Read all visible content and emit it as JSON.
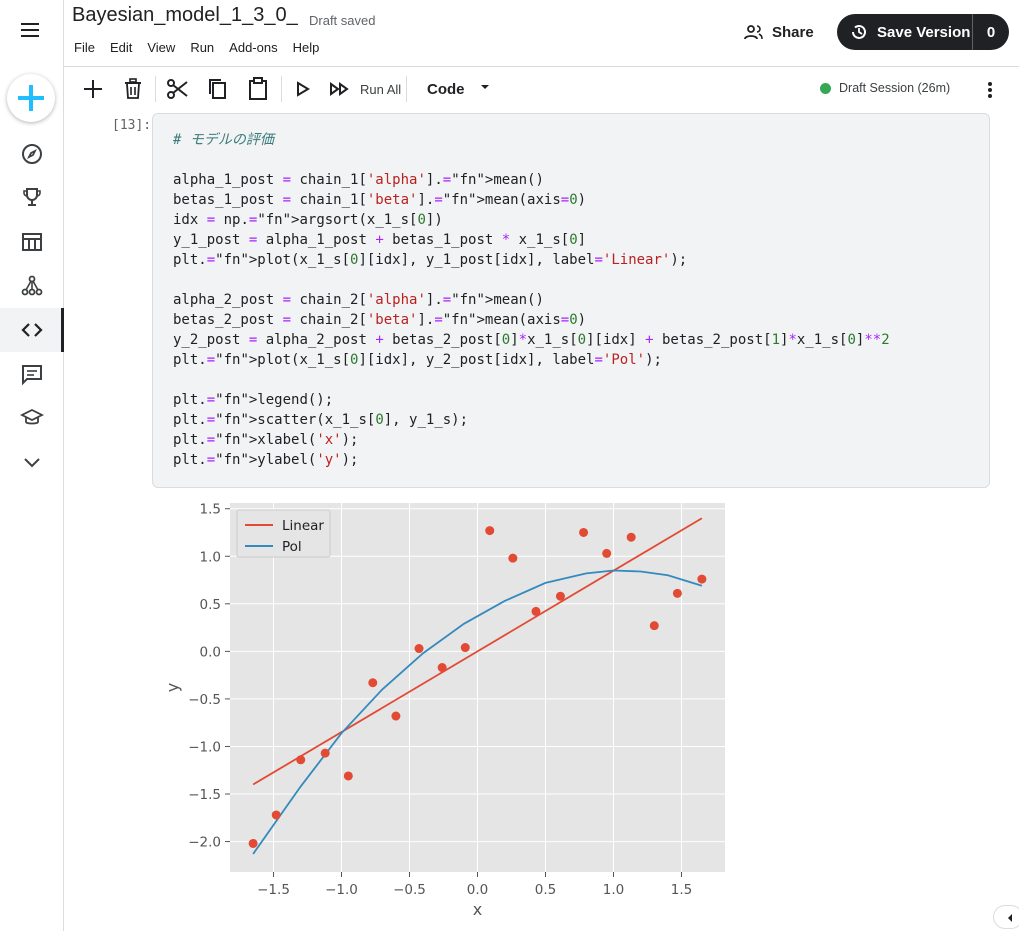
{
  "app": {
    "notebook_title": "Bayesian_model_1_3_0_",
    "save_status": "Draft saved",
    "menus": [
      "File",
      "Edit",
      "View",
      "Run",
      "Add-ons",
      "Help"
    ],
    "share_label": "Share",
    "save_version_label": "Save Version",
    "version_count": "0"
  },
  "sidebar": {
    "icons": [
      "menu-icon",
      "create-icon",
      "explore-icon",
      "competitions-icon",
      "datasets-icon",
      "models-icon",
      "code-icon",
      "discussions-icon",
      "learn-icon",
      "more-icon"
    ],
    "active": "code-icon"
  },
  "toolbar": {
    "run_all_label": "Run All",
    "cell_type": "Code",
    "session_status": "Draft Session (26m)",
    "session_color": "#34a853"
  },
  "cell": {
    "execution_count": "[13]:",
    "lines": [
      "# モデルの評価",
      "",
      "alpha_1_post = chain_1['alpha'].mean()",
      "betas_1_post = chain_1['beta'].mean(axis=0)",
      "idx = np.argsort(x_1_s[0])",
      "y_1_post = alpha_1_post + betas_1_post * x_1_s[0]",
      "plt.plot(x_1_s[0][idx], y_1_post[idx], label='Linear');",
      "",
      "alpha_2_post = chain_2['alpha'].mean()",
      "betas_2_post = chain_2['beta'].mean(axis=0)",
      "y_2_post = alpha_2_post + betas_2_post[0]*x_1_s[0][idx] + betas_2_post[1]*x_1_s[0]**2",
      "plt.plot(x_1_s[0][idx], y_2_post[idx], label='Pol');",
      "",
      "plt.legend();",
      "plt.scatter(x_1_s[0], y_1_s);",
      "plt.xlabel('x');",
      "plt.ylabel('y');"
    ]
  },
  "chart_data": {
    "type": "scatter",
    "xlabel": "x",
    "ylabel": "y",
    "xlim": [
      -1.82,
      1.82
    ],
    "ylim": [
      -2.32,
      1.56
    ],
    "x_ticks": [
      -1.5,
      -1.0,
      -0.5,
      0.0,
      0.5,
      1.0,
      1.5
    ],
    "x_tick_labels": [
      "−1.5",
      "−1.0",
      "−0.5",
      "0.0",
      "0.5",
      "1.0",
      "1.5"
    ],
    "y_ticks": [
      -2.0,
      -1.5,
      -1.0,
      -0.5,
      0.0,
      0.5,
      1.0,
      1.5
    ],
    "y_tick_labels": [
      "−2.0",
      "−1.5",
      "−1.0",
      "−0.5",
      "0.0",
      "0.5",
      "1.0",
      "1.5"
    ],
    "grid": true,
    "legend_position": "top-left",
    "background": "#e5e5e5",
    "series": [
      {
        "name": "Linear",
        "kind": "line",
        "color": "#e24a33",
        "x": [
          -1.65,
          1.65
        ],
        "y": [
          -1.4,
          1.4
        ]
      },
      {
        "name": "Pol",
        "kind": "line",
        "color": "#348abd",
        "x": [
          -1.65,
          -1.3,
          -1.0,
          -0.7,
          -0.4,
          -0.1,
          0.2,
          0.5,
          0.8,
          1.0,
          1.2,
          1.4,
          1.65
        ],
        "y": [
          -2.13,
          -1.42,
          -0.86,
          -0.4,
          -0.02,
          0.29,
          0.53,
          0.72,
          0.82,
          0.85,
          0.84,
          0.8,
          0.69
        ]
      },
      {
        "kind": "scatter",
        "color": "#e24a33",
        "x": [
          -1.65,
          -1.48,
          -1.3,
          -1.12,
          -0.95,
          -0.77,
          -0.6,
          -0.43,
          -0.26,
          -0.09,
          0.09,
          0.26,
          0.43,
          0.61,
          0.78,
          0.95,
          1.13,
          1.3,
          1.47,
          1.65
        ],
        "y": [
          -2.02,
          -1.72,
          -1.14,
          -1.07,
          -1.31,
          -0.33,
          -0.68,
          0.03,
          -0.17,
          0.04,
          1.27,
          0.98,
          0.42,
          0.58,
          1.25,
          1.03,
          1.2,
          0.27,
          0.61,
          0.76
        ]
      }
    ]
  }
}
